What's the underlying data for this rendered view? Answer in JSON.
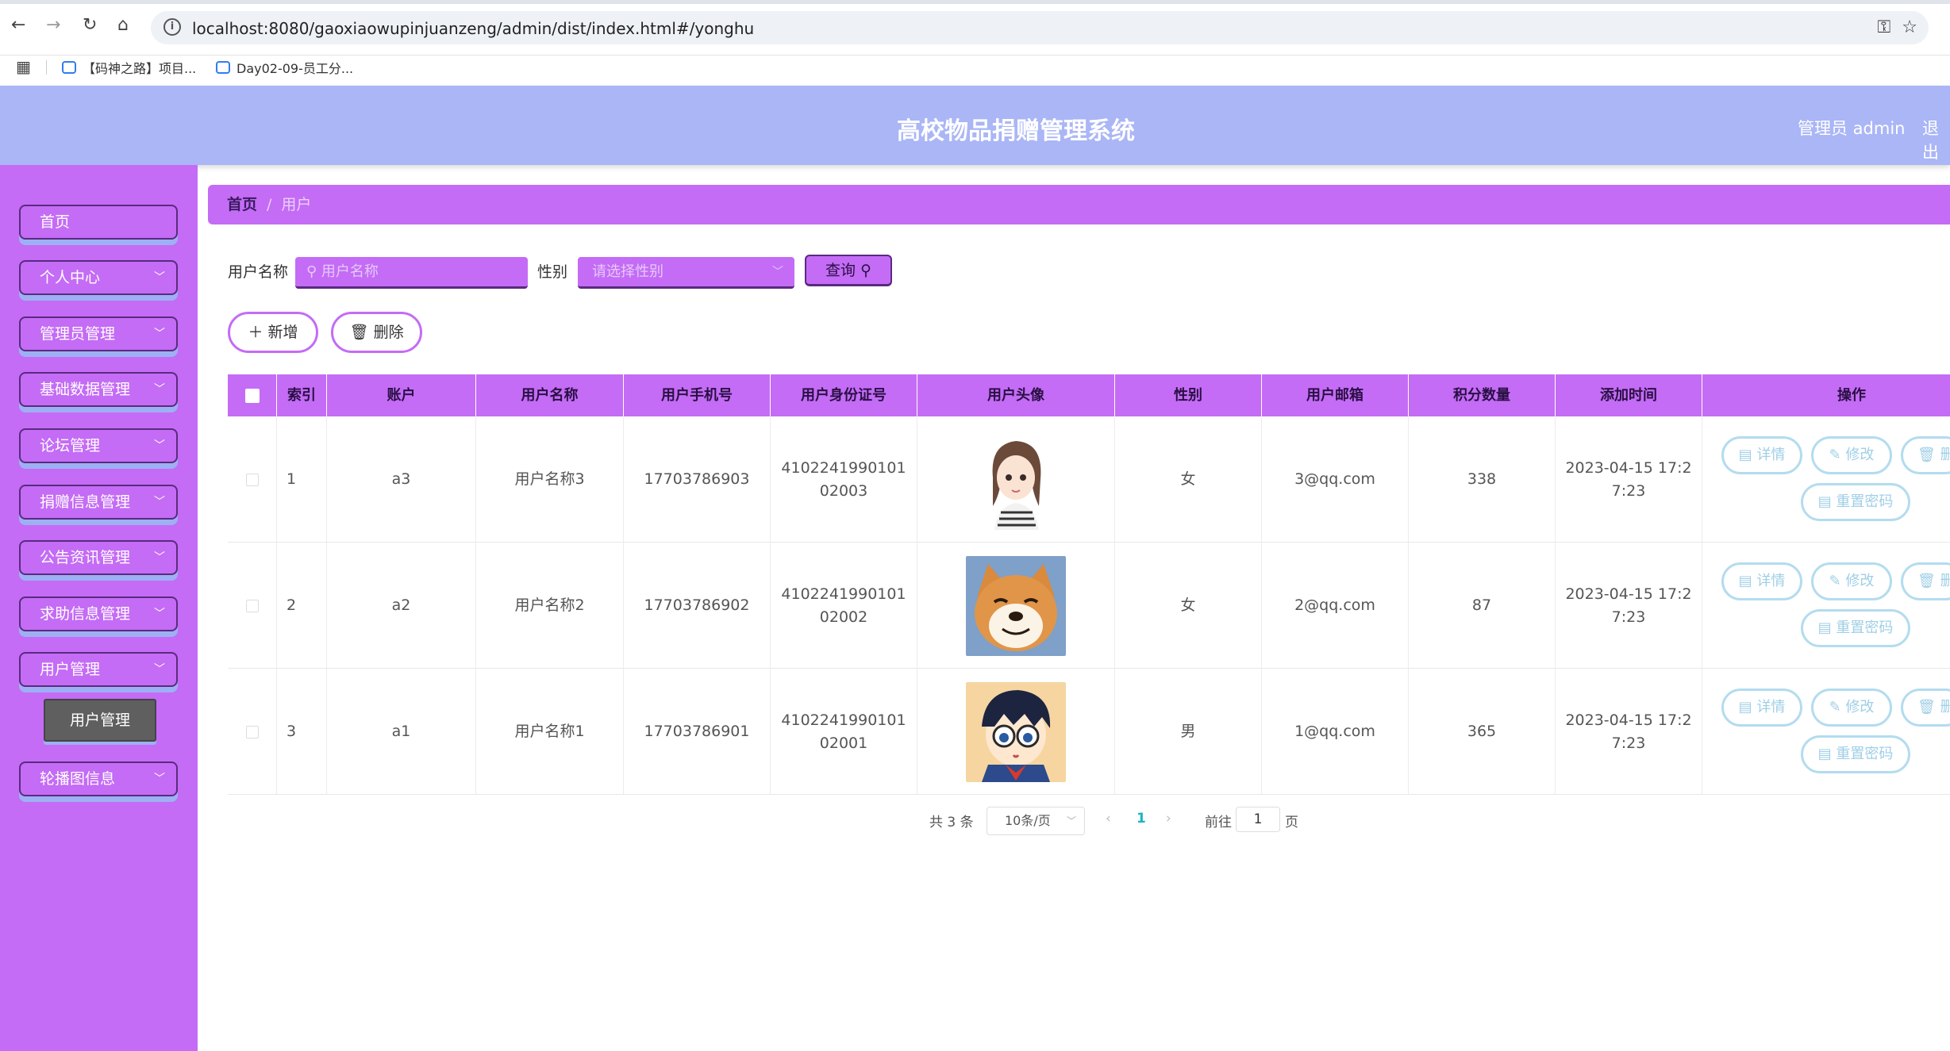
{
  "browser": {
    "url": "localhost:8080/gaoxiaowupinjuanzeng/admin/dist/index.html#/yonghu",
    "bookmarks": [
      "【码神之路】项目...",
      "Day02-09-员工分..."
    ]
  },
  "header": {
    "title": "高校物品捐赠管理系统",
    "user": "管理员 admin",
    "logout": "退出"
  },
  "sidebar": {
    "items": [
      {
        "label": "首页",
        "has_arrow": false
      },
      {
        "label": "个人中心",
        "has_arrow": true
      },
      {
        "label": "管理员管理",
        "has_arrow": true
      },
      {
        "label": "基础数据管理",
        "has_arrow": true
      },
      {
        "label": "论坛管理",
        "has_arrow": true
      },
      {
        "label": "捐赠信息管理",
        "has_arrow": true
      },
      {
        "label": "公告资讯管理",
        "has_arrow": true
      },
      {
        "label": "求助信息管理",
        "has_arrow": true
      },
      {
        "label": "用户管理",
        "has_arrow": true
      },
      {
        "label": "轮播图信息",
        "has_arrow": true
      }
    ],
    "active_sub": "用户管理"
  },
  "breadcrumb": {
    "home": "首页",
    "separator": "/",
    "current": "用户"
  },
  "search": {
    "name_label": "用户名称",
    "name_placeholder": "用户名称",
    "gender_label": "性别",
    "gender_placeholder": "请选择性别",
    "query_button": "查询"
  },
  "actions": {
    "add": "新增",
    "delete": "删除"
  },
  "table": {
    "columns": [
      "索引",
      "账户",
      "用户名称",
      "用户手机号",
      "用户身份证号",
      "用户头像",
      "性别",
      "用户邮箱",
      "积分数量",
      "添加时间",
      "操作"
    ],
    "rows": [
      {
        "index": "1",
        "account": "a3",
        "name": "用户名称3",
        "phone": "17703786903",
        "id_card": "410224199010102003",
        "avatar": "girl",
        "gender": "女",
        "email": "3@qq.com",
        "points": "338",
        "time": "2023-04-15 17:27:23"
      },
      {
        "index": "2",
        "account": "a2",
        "name": "用户名称2",
        "phone": "17703786902",
        "id_card": "410224199010102002",
        "avatar": "dog",
        "gender": "女",
        "email": "2@qq.com",
        "points": "87",
        "time": "2023-04-15 17:27:23"
      },
      {
        "index": "3",
        "account": "a1",
        "name": "用户名称1",
        "phone": "17703786901",
        "id_card": "410224199010102001",
        "avatar": "boy",
        "gender": "男",
        "email": "1@qq.com",
        "points": "365",
        "time": "2023-04-15 17:27:23"
      }
    ],
    "row_actions": {
      "detail": "详情",
      "edit": "修改",
      "delete": "删",
      "reset": "重置密码"
    }
  },
  "pagination": {
    "total": "共 3 条",
    "page_size": "10条/页",
    "current_page": "1",
    "goto_label": "前往",
    "goto_value": "1",
    "page_suffix": "页"
  },
  "colors": {
    "primary": "#c46cf5",
    "header": "#aab6f5",
    "action_border": "#b3dcef"
  }
}
